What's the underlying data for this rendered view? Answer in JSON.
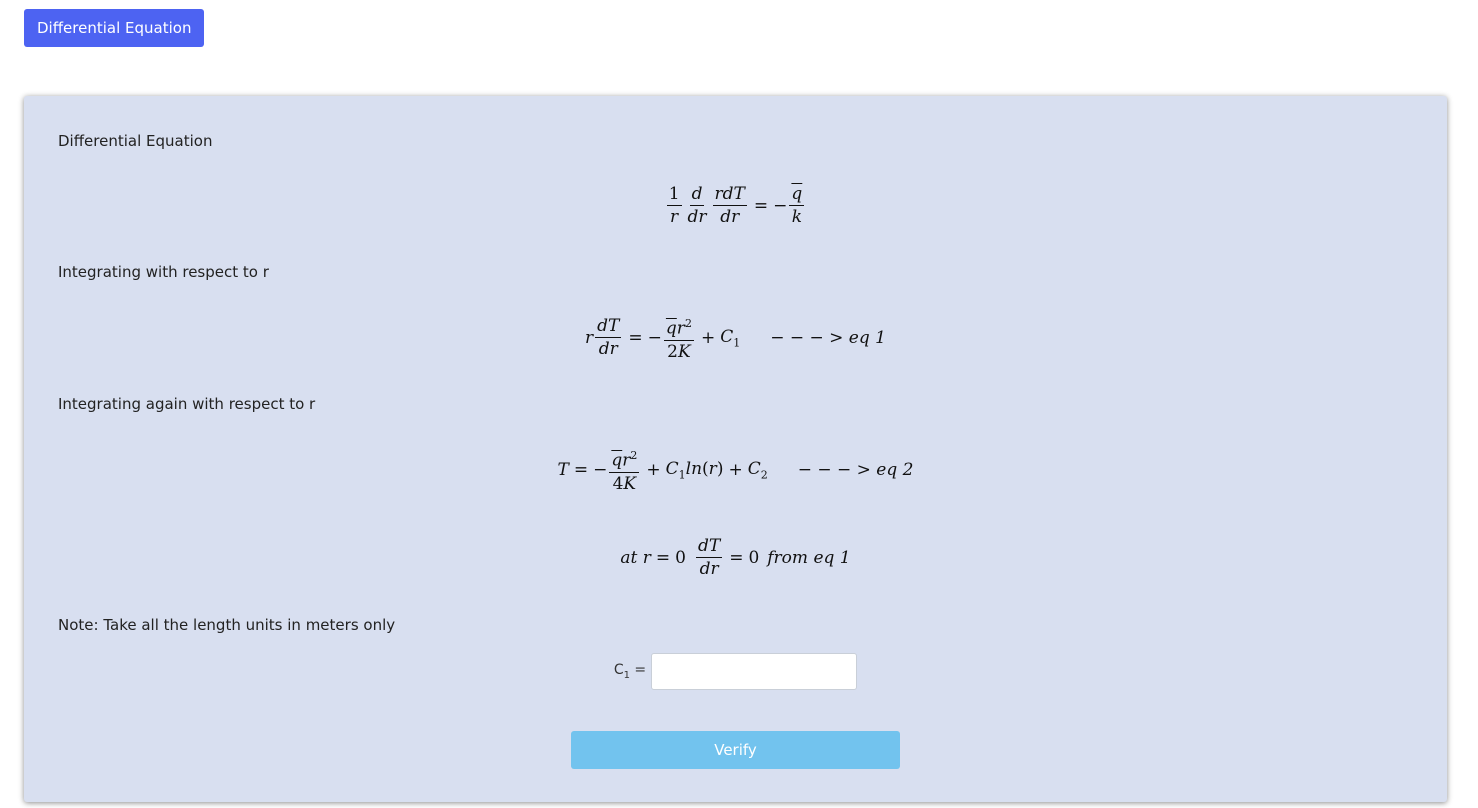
{
  "header": {
    "button_label": "Differential Equation"
  },
  "card": {
    "heading": "Differential Equation",
    "step1_text": "Integrating with respect to r",
    "step2_text": "Integrating again with respect to r",
    "note": "Note: Take all the length units in meters only",
    "eq1_tag": "− − − > eq 1",
    "eq2_tag": "− − − > eq 2",
    "bc_text": "from eq 1",
    "input_label": "C",
    "input_label_sub": "1",
    "input_suffix": " =",
    "input_value": "",
    "input_placeholder": "",
    "verify_label": "Verify"
  },
  "colors": {
    "accent": "#4d63f2",
    "card_bg": "#d8dff0",
    "verify_bg": "#72c3ee"
  }
}
